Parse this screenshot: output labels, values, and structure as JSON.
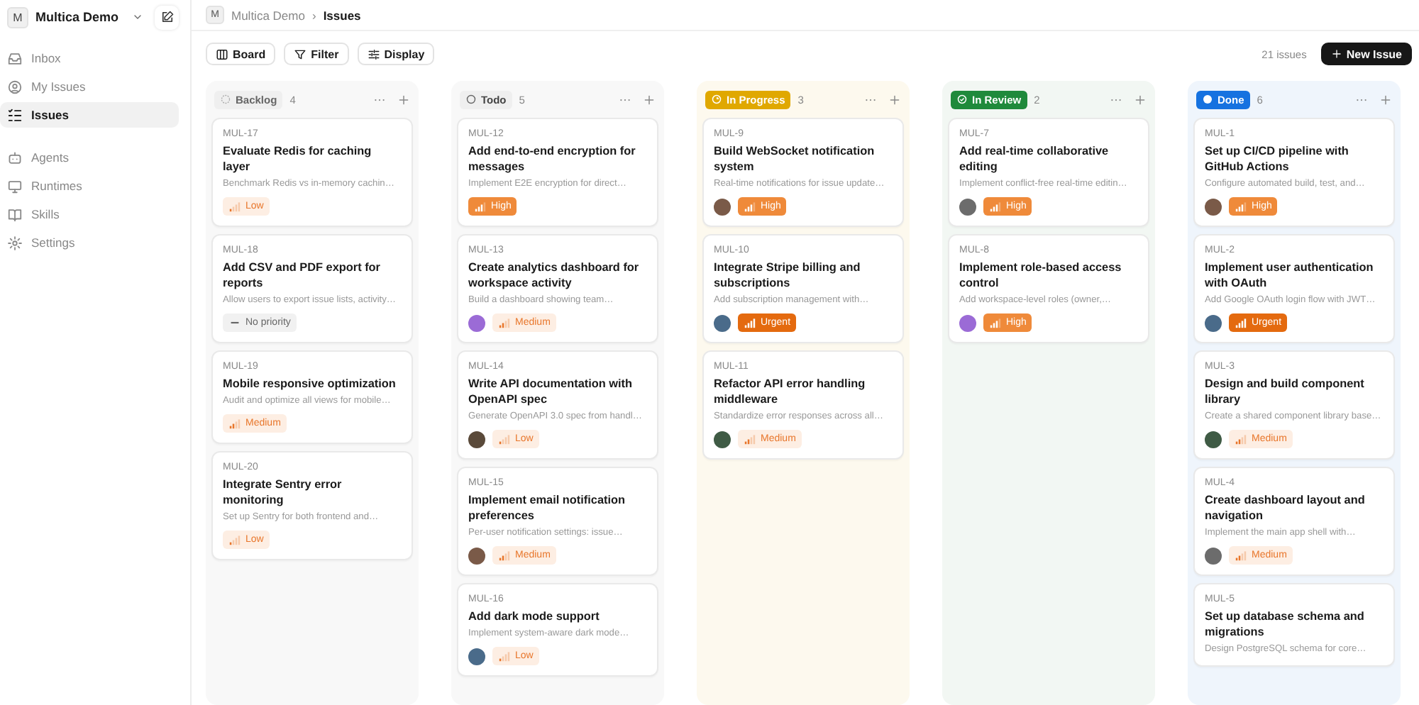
{
  "workspace": {
    "initial": "M",
    "name": "Multica Demo"
  },
  "sidebar": {
    "groups": [
      {
        "items": [
          {
            "label": "Inbox",
            "selected": false
          },
          {
            "label": "My Issues",
            "selected": false
          },
          {
            "label": "Issues",
            "selected": true
          }
        ]
      },
      {
        "items": [
          {
            "label": "Agents",
            "selected": false
          },
          {
            "label": "Runtimes",
            "selected": false
          },
          {
            "label": "Skills",
            "selected": false
          },
          {
            "label": "Settings",
            "selected": false
          }
        ]
      }
    ]
  },
  "breadcrumb": {
    "initial": "M",
    "workspace": "Multica Demo",
    "separator": "›",
    "page": "Issues"
  },
  "toolbar": {
    "buttons": [
      "Board",
      "Filter",
      "Display"
    ],
    "count": "21 issues",
    "new_button": "New Issue"
  },
  "columns": [
    {
      "kind": "backlog",
      "label": "Backlog",
      "count": "4",
      "cards": [
        {
          "id": "MUL-17",
          "title": "Evaluate Redis for caching layer",
          "description": "Benchmark Redis vs in-memory cachin…",
          "priority": {
            "kind": "low",
            "label": "Low"
          },
          "assignee": false
        },
        {
          "id": "MUL-18",
          "title": "Add CSV and PDF export for reports",
          "description": "Allow users to export issue lists, activity…",
          "priority": {
            "kind": "none",
            "label": "No priority"
          },
          "assignee": false
        },
        {
          "id": "MUL-19",
          "title": "Mobile responsive optimization",
          "description": "Audit and optimize all views for mobile…",
          "priority": {
            "kind": "medium",
            "label": "Medium"
          },
          "assignee": false
        },
        {
          "id": "MUL-20",
          "title": "Integrate Sentry error monitoring",
          "description": "Set up Sentry for both frontend and…",
          "priority": {
            "kind": "low",
            "label": "Low"
          },
          "assignee": false
        }
      ]
    },
    {
      "kind": "todo",
      "label": "Todo",
      "count": "5",
      "cards": [
        {
          "id": "MUL-12",
          "title": "Add end-to-end encryption for messages",
          "description": "Implement E2E encryption for direct…",
          "priority": {
            "kind": "high",
            "label": "High"
          },
          "assignee": false
        },
        {
          "id": "MUL-13",
          "title": "Create analytics dashboard for workspace activity",
          "description": "Build a dashboard showing team…",
          "priority": {
            "kind": "medium",
            "label": "Medium"
          },
          "assignee": true
        },
        {
          "id": "MUL-14",
          "title": "Write API documentation with OpenAPI spec",
          "description": "Generate OpenAPI 3.0 spec from handl…",
          "priority": {
            "kind": "low",
            "label": "Low"
          },
          "assignee": true
        },
        {
          "id": "MUL-15",
          "title": "Implement email notification preferences",
          "description": "Per-user notification settings: issue…",
          "priority": {
            "kind": "medium",
            "label": "Medium"
          },
          "assignee": true
        },
        {
          "id": "MUL-16",
          "title": "Add dark mode support",
          "description": "Implement system-aware dark mode…",
          "priority": {
            "kind": "low",
            "label": "Low"
          },
          "assignee": true
        }
      ]
    },
    {
      "kind": "in_progress",
      "label": "In Progress",
      "count": "3",
      "cards": [
        {
          "id": "MUL-9",
          "title": "Build WebSocket notification system",
          "description": "Real-time notifications for issue update…",
          "priority": {
            "kind": "high",
            "label": "High"
          },
          "assignee": true
        },
        {
          "id": "MUL-10",
          "title": "Integrate Stripe billing and subscriptions",
          "description": "Add subscription management with…",
          "priority": {
            "kind": "urgent",
            "label": "Urgent"
          },
          "assignee": true
        },
        {
          "id": "MUL-11",
          "title": "Refactor API error handling middleware",
          "description": "Standardize error responses across all…",
          "priority": {
            "kind": "medium",
            "label": "Medium"
          },
          "assignee": true
        }
      ]
    },
    {
      "kind": "in_review",
      "label": "In Review",
      "count": "2",
      "cards": [
        {
          "id": "MUL-7",
          "title": "Add real-time collaborative editing",
          "description": "Implement conflict-free real-time editin…",
          "priority": {
            "kind": "high",
            "label": "High"
          },
          "assignee": true
        },
        {
          "id": "MUL-8",
          "title": "Implement role-based access control",
          "description": "Add workspace-level roles (owner,…",
          "priority": {
            "kind": "high",
            "label": "High"
          },
          "assignee": true
        }
      ]
    },
    {
      "kind": "done",
      "label": "Done",
      "count": "6",
      "cards": [
        {
          "id": "MUL-1",
          "title": "Set up CI/CD pipeline with GitHub Actions",
          "description": "Configure automated build, test, and…",
          "priority": {
            "kind": "high",
            "label": "High"
          },
          "assignee": true
        },
        {
          "id": "MUL-2",
          "title": "Implement user authentication with OAuth",
          "description": "Add Google OAuth login flow with JWT…",
          "priority": {
            "kind": "urgent",
            "label": "Urgent"
          },
          "assignee": true
        },
        {
          "id": "MUL-3",
          "title": "Design and build component library",
          "description": "Create a shared component library base…",
          "priority": {
            "kind": "medium",
            "label": "Medium"
          },
          "assignee": true
        },
        {
          "id": "MUL-4",
          "title": "Create dashboard layout and navigation",
          "description": "Implement the main app shell with…",
          "priority": {
            "kind": "medium",
            "label": "Medium"
          },
          "assignee": true
        },
        {
          "id": "MUL-5",
          "title": "Set up database schema and migrations",
          "description": "Design PostgreSQL schema for core…"
        }
      ]
    }
  ]
}
